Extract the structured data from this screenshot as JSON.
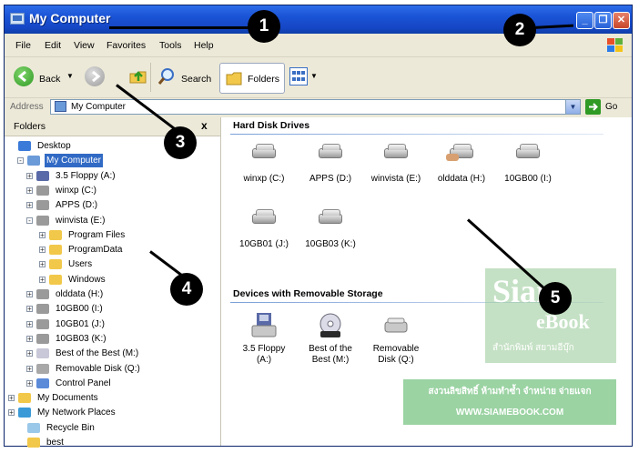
{
  "window": {
    "title": "My Computer",
    "controls": [
      "minimize",
      "restore",
      "close"
    ]
  },
  "menu": [
    "File",
    "Edit",
    "View",
    "Favorites",
    "Tools",
    "Help"
  ],
  "toolbar": {
    "back_label": "Back",
    "search_label": "Search",
    "folders_label": "Folders"
  },
  "address": {
    "label": "Address",
    "value": "My Computer",
    "go_label": "Go"
  },
  "folders_pane": {
    "title": "Folders",
    "close": "x",
    "tree": [
      {
        "label": "Desktop",
        "expander": ""
      },
      {
        "label": "My Computer",
        "expander": "-",
        "selected": true
      },
      {
        "label": "3.5 Floppy (A:)",
        "expander": "+"
      },
      {
        "label": "winxp (C:)",
        "expander": "+"
      },
      {
        "label": "APPS (D:)",
        "expander": "+"
      },
      {
        "label": "winvista (E:)",
        "expander": "-"
      },
      {
        "label": "Program Files",
        "expander": "+"
      },
      {
        "label": "ProgramData",
        "expander": "+"
      },
      {
        "label": "Users",
        "expander": "+"
      },
      {
        "label": "Windows",
        "expander": "+"
      },
      {
        "label": "olddata (H:)",
        "expander": "+"
      },
      {
        "label": "10GB00 (I:)",
        "expander": "+"
      },
      {
        "label": "10GB01 (J:)",
        "expander": "+"
      },
      {
        "label": "10GB03 (K:)",
        "expander": "+"
      },
      {
        "label": "Best of the Best (M:)",
        "expander": "+"
      },
      {
        "label": "Removable Disk (Q:)",
        "expander": "+"
      },
      {
        "label": "Control Panel",
        "expander": "+"
      },
      {
        "label": "My Documents",
        "expander": "+"
      },
      {
        "label": "My Network Places",
        "expander": "+"
      },
      {
        "label": "Recycle Bin",
        "expander": ""
      },
      {
        "label": "best",
        "expander": ""
      }
    ]
  },
  "content": {
    "hard_disk_title": "Hard Disk Drives",
    "hard_disks": [
      "winxp (C:)",
      "APPS (D:)",
      "winvista (E:)",
      "olddata (H:)",
      "10GB00 (I:)",
      "10GB01 (J:)",
      "10GB03 (K:)"
    ],
    "removable_title": "Devices with Removable Storage",
    "removable": [
      {
        "line1": "3.5 Floppy",
        "line2": "(A:)",
        "icon": "floppy-icon"
      },
      {
        "line1": "Best of the",
        "line2": "Best (M:)",
        "icon": "cd-icon"
      },
      {
        "line1": "Removable",
        "line2": "Disk (Q:)",
        "icon": "removable-disk-icon"
      }
    ]
  },
  "callouts": [
    "1",
    "2",
    "3",
    "4",
    "5"
  ],
  "watermark": {
    "brand_line1": "Siam",
    "brand_line2": "eBook",
    "brand_thai": "สำนักพิมพ์ สยามอีบุ๊ก",
    "notice": "สงวนลิขสิทธิ์ ห้ามทำซ้ำ จำหน่าย จ่ายแจก",
    "url": "WWW.SIAMEBOOK.COM"
  },
  "colors": {
    "titlebar": "#1a53d6",
    "selection": "#316ac5",
    "watermark": "#7cc88c"
  }
}
